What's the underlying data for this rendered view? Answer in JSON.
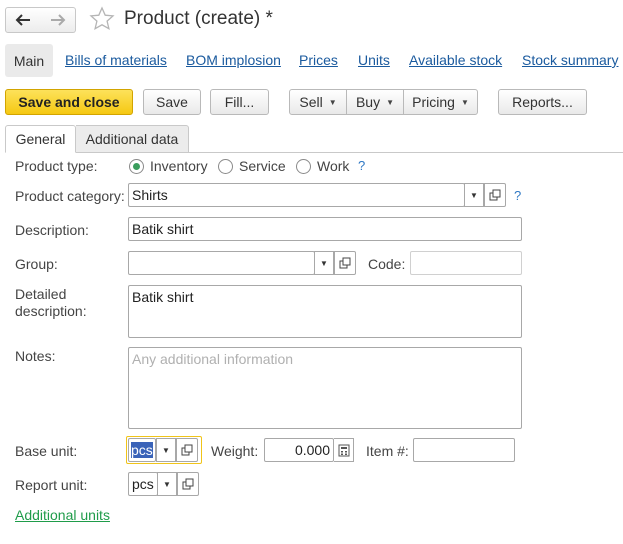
{
  "header": {
    "title": "Product (create) *",
    "back_icon": "arrow-left-icon",
    "forward_icon": "arrow-right-icon",
    "favorite_icon": "star-icon"
  },
  "nav": {
    "main": "Main",
    "links": [
      "Bills of materials",
      "BOM implosion",
      "Prices",
      "Units",
      "Available stock",
      "Stock summary"
    ]
  },
  "toolbar": {
    "save_close": "Save and close",
    "save": "Save",
    "fill": "Fill...",
    "sell": "Sell",
    "buy": "Buy",
    "pricing": "Pricing",
    "reports": "Reports..."
  },
  "tabs": {
    "general": "General",
    "additional": "Additional data"
  },
  "form": {
    "product_type_label": "Product type:",
    "types": [
      "Inventory",
      "Service",
      "Work"
    ],
    "selected_type": "Inventory",
    "help": "?",
    "category_label": "Product category:",
    "category_value": "Shirts",
    "description_label": "Description:",
    "description_value": "Batik shirt",
    "group_label": "Group:",
    "group_value": "",
    "code_label": "Code:",
    "code_value": "",
    "detailed_label_1": "Detailed",
    "detailed_label_2": "description:",
    "detailed_value": "Batik shirt",
    "notes_label": "Notes:",
    "notes_placeholder": "Any additional information",
    "base_unit_label": "Base unit:",
    "base_unit_value": "pcs",
    "weight_label": "Weight:",
    "weight_value": "0.000",
    "item_label": "Item #:",
    "item_value": "",
    "report_unit_label": "Report unit:",
    "report_unit_value": "pcs",
    "additional_units_link": "Additional units"
  },
  "colors": {
    "primary_button": "#f5c812",
    "link": "#1a5a9e",
    "green_link": "#1f9c4a",
    "radio_dot": "#3a9d5d",
    "selection": "#3a63b8"
  }
}
